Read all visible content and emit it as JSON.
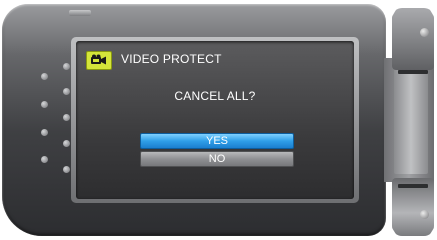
{
  "menu": {
    "mode_icon": "video-camera-icon",
    "title": "VIDEO PROTECT",
    "prompt": "CANCEL ALL?",
    "options": [
      {
        "label": "YES",
        "selected": true
      },
      {
        "label": "NO",
        "selected": false
      }
    ]
  },
  "colors": {
    "selected_button": "#2f9fe8",
    "unselected_button": "#8f9093",
    "mode_badge": "#d4e53a",
    "screen_background": "#3b3b3d"
  }
}
